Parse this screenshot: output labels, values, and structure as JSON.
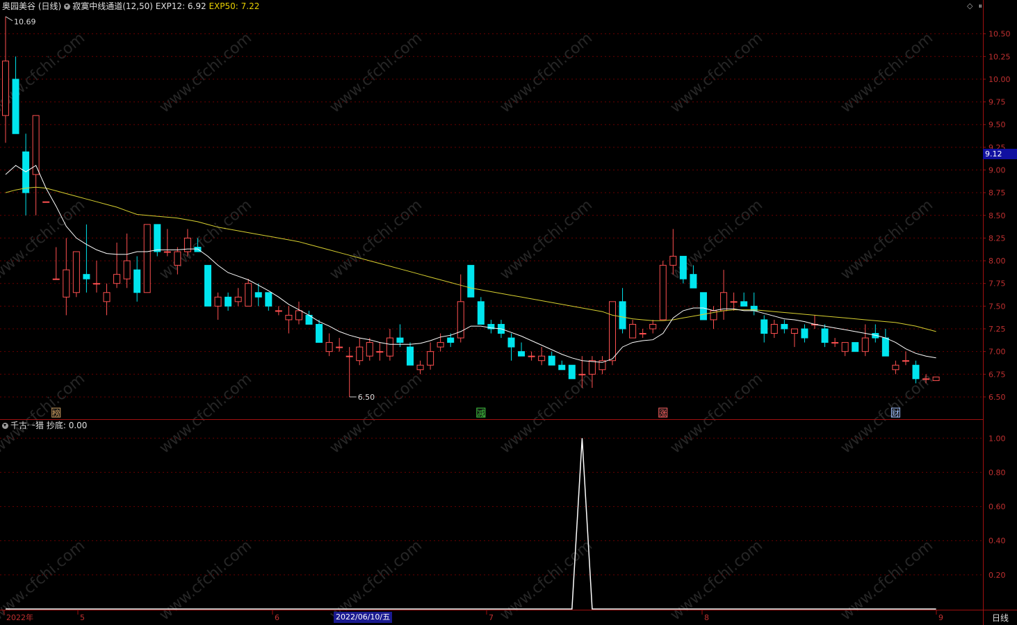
{
  "header": {
    "stock_name": "奥园美谷 (日线)",
    "indicator_name": "寂寞中线通道(12,50)",
    "exp12_label": "EXP12: 6.92",
    "exp50_label": "EXP50: 7.22"
  },
  "sub_header": {
    "indicator_name": "千古一猎",
    "value_label": "抄底: 0.00"
  },
  "price_axis": {
    "ticks": [
      "10.50",
      "10.25",
      "10.00",
      "9.75",
      "9.50",
      "9.25",
      "9.00",
      "8.75",
      "8.50",
      "8.25",
      "8.00",
      "7.75",
      "7.50",
      "7.25",
      "7.00",
      "6.75",
      "6.50"
    ],
    "current_price": "9.12"
  },
  "sub_axis": {
    "ticks": [
      "1.00",
      "0.80",
      "0.60",
      "0.40",
      "0.20"
    ]
  },
  "annotations": {
    "high": "10.69",
    "low": "6.50"
  },
  "event_markers": [
    {
      "label": "榜",
      "color": "#d0a060"
    },
    {
      "label": "减",
      "color": "#40d040"
    },
    {
      "label": "涨",
      "color": "#ff6060"
    },
    {
      "label": "财",
      "color": "#a0c0ff"
    }
  ],
  "date_axis": {
    "labels": [
      "2022年",
      "5",
      "6",
      "7",
      "8",
      "9"
    ],
    "cursor_date": "2022/06/10/五",
    "period": "日线"
  },
  "watermark": "www.cfchi.com",
  "colors": {
    "up": "#ff5050",
    "down": "#00e5ee",
    "exp12": "#ffffff",
    "exp50": "#d8d030",
    "grid": "#6a0000",
    "axis": "#a01010"
  },
  "chart_data": {
    "type": "candlestick",
    "ylim": [
      6.4,
      10.75
    ],
    "candles": [
      {
        "o": 9.6,
        "h": 10.69,
        "l": 9.3,
        "c": 10.2
      },
      {
        "o": 10.0,
        "h": 10.25,
        "l": 9.4,
        "c": 9.4
      },
      {
        "o": 9.2,
        "h": 9.4,
        "l": 8.5,
        "c": 8.75
      },
      {
        "o": 8.95,
        "h": 9.6,
        "l": 8.5,
        "c": 9.6
      },
      {
        "o": 8.65,
        "h": 8.65,
        "l": 8.65,
        "c": 8.65
      },
      {
        "o": 7.8,
        "h": 8.15,
        "l": 7.8,
        "c": 7.8
      },
      {
        "o": 7.6,
        "h": 8.25,
        "l": 7.4,
        "c": 7.9
      },
      {
        "o": 7.65,
        "h": 8.1,
        "l": 7.6,
        "c": 8.1
      },
      {
        "o": 7.85,
        "h": 8.4,
        "l": 7.65,
        "c": 7.8
      },
      {
        "o": 7.75,
        "h": 8.0,
        "l": 7.65,
        "c": 7.75
      },
      {
        "o": 7.55,
        "h": 7.75,
        "l": 7.4,
        "c": 7.65
      },
      {
        "o": 7.75,
        "h": 8.2,
        "l": 7.7,
        "c": 7.85
      },
      {
        "o": 7.8,
        "h": 8.3,
        "l": 7.7,
        "c": 8.0
      },
      {
        "o": 7.9,
        "h": 8.05,
        "l": 7.55,
        "c": 7.65
      },
      {
        "o": 7.65,
        "h": 8.35,
        "l": 7.65,
        "c": 8.4
      },
      {
        "o": 8.4,
        "h": 8.4,
        "l": 8.05,
        "c": 8.1
      },
      {
        "o": 8.1,
        "h": 8.35,
        "l": 8.05,
        "c": 8.1
      },
      {
        "o": 7.95,
        "h": 8.15,
        "l": 7.85,
        "c": 8.1
      },
      {
        "o": 8.1,
        "h": 8.35,
        "l": 8.05,
        "c": 8.25
      },
      {
        "o": 8.15,
        "h": 8.25,
        "l": 8.1,
        "c": 8.1
      },
      {
        "o": 7.95,
        "h": 7.95,
        "l": 7.5,
        "c": 7.5
      },
      {
        "o": 7.5,
        "h": 7.65,
        "l": 7.35,
        "c": 7.6
      },
      {
        "o": 7.6,
        "h": 7.65,
        "l": 7.45,
        "c": 7.5
      },
      {
        "o": 7.55,
        "h": 7.7,
        "l": 7.5,
        "c": 7.6
      },
      {
        "o": 7.5,
        "h": 7.8,
        "l": 7.5,
        "c": 7.75
      },
      {
        "o": 7.65,
        "h": 7.75,
        "l": 7.5,
        "c": 7.6
      },
      {
        "o": 7.65,
        "h": 7.65,
        "l": 7.45,
        "c": 7.5
      },
      {
        "o": 7.45,
        "h": 7.5,
        "l": 7.4,
        "c": 7.45
      },
      {
        "o": 7.35,
        "h": 7.5,
        "l": 7.2,
        "c": 7.4
      },
      {
        "o": 7.35,
        "h": 7.55,
        "l": 7.3,
        "c": 7.45
      },
      {
        "o": 7.4,
        "h": 7.45,
        "l": 7.3,
        "c": 7.3
      },
      {
        "o": 7.3,
        "h": 7.35,
        "l": 7.1,
        "c": 7.1
      },
      {
        "o": 7.0,
        "h": 7.2,
        "l": 6.95,
        "c": 7.1
      },
      {
        "o": 7.05,
        "h": 7.15,
        "l": 7.0,
        "c": 7.05
      },
      {
        "o": 6.95,
        "h": 7.05,
        "l": 6.5,
        "c": 6.95
      },
      {
        "o": 6.9,
        "h": 7.15,
        "l": 6.85,
        "c": 7.05
      },
      {
        "o": 6.95,
        "h": 7.15,
        "l": 6.9,
        "c": 7.1
      },
      {
        "o": 7.0,
        "h": 7.1,
        "l": 6.9,
        "c": 7.0
      },
      {
        "o": 6.95,
        "h": 7.25,
        "l": 6.9,
        "c": 7.15
      },
      {
        "o": 7.15,
        "h": 7.3,
        "l": 7.05,
        "c": 7.1
      },
      {
        "o": 7.05,
        "h": 7.1,
        "l": 6.85,
        "c": 6.85
      },
      {
        "o": 6.8,
        "h": 6.9,
        "l": 6.75,
        "c": 6.85
      },
      {
        "o": 6.85,
        "h": 7.1,
        "l": 6.8,
        "c": 7.0
      },
      {
        "o": 7.05,
        "h": 7.2,
        "l": 7.0,
        "c": 7.1
      },
      {
        "o": 7.15,
        "h": 7.2,
        "l": 7.05,
        "c": 7.1
      },
      {
        "o": 7.15,
        "h": 7.85,
        "l": 7.1,
        "c": 7.55
      },
      {
        "o": 7.95,
        "h": 7.95,
        "l": 7.6,
        "c": 7.6
      },
      {
        "o": 7.55,
        "h": 7.6,
        "l": 7.3,
        "c": 7.3
      },
      {
        "o": 7.3,
        "h": 7.35,
        "l": 7.2,
        "c": 7.25
      },
      {
        "o": 7.3,
        "h": 7.35,
        "l": 7.15,
        "c": 7.2
      },
      {
        "o": 7.15,
        "h": 7.2,
        "l": 6.9,
        "c": 7.05
      },
      {
        "o": 7.0,
        "h": 7.1,
        "l": 6.95,
        "c": 6.95
      },
      {
        "o": 6.95,
        "h": 7.0,
        "l": 6.9,
        "c": 6.95
      },
      {
        "o": 6.9,
        "h": 7.05,
        "l": 6.85,
        "c": 6.95
      },
      {
        "o": 6.95,
        "h": 7.0,
        "l": 6.85,
        "c": 6.85
      },
      {
        "o": 6.85,
        "h": 6.9,
        "l": 6.8,
        "c": 6.8
      },
      {
        "o": 6.85,
        "h": 6.85,
        "l": 6.7,
        "c": 6.7
      },
      {
        "o": 6.75,
        "h": 6.95,
        "l": 6.6,
        "c": 6.75
      },
      {
        "o": 6.75,
        "h": 6.95,
        "l": 6.6,
        "c": 6.9
      },
      {
        "o": 6.8,
        "h": 6.95,
        "l": 6.75,
        "c": 6.9
      },
      {
        "o": 6.9,
        "h": 7.55,
        "l": 6.85,
        "c": 7.55
      },
      {
        "o": 7.55,
        "h": 7.7,
        "l": 7.2,
        "c": 7.25
      },
      {
        "o": 7.15,
        "h": 7.35,
        "l": 7.15,
        "c": 7.3
      },
      {
        "o": 7.2,
        "h": 7.25,
        "l": 7.15,
        "c": 7.2
      },
      {
        "o": 7.25,
        "h": 7.35,
        "l": 7.2,
        "c": 7.3
      },
      {
        "o": 7.35,
        "h": 8.0,
        "l": 7.35,
        "c": 7.95
      },
      {
        "o": 7.95,
        "h": 8.35,
        "l": 7.85,
        "c": 8.05
      },
      {
        "o": 8.05,
        "h": 8.05,
        "l": 7.75,
        "c": 7.8
      },
      {
        "o": 7.85,
        "h": 7.95,
        "l": 7.7,
        "c": 7.7
      },
      {
        "o": 7.65,
        "h": 7.65,
        "l": 7.35,
        "c": 7.35
      },
      {
        "o": 7.35,
        "h": 7.5,
        "l": 7.25,
        "c": 7.45
      },
      {
        "o": 7.45,
        "h": 7.9,
        "l": 7.35,
        "c": 7.65
      },
      {
        "o": 7.55,
        "h": 7.65,
        "l": 7.45,
        "c": 7.55
      },
      {
        "o": 7.55,
        "h": 7.65,
        "l": 7.5,
        "c": 7.5
      },
      {
        "o": 7.5,
        "h": 7.65,
        "l": 7.4,
        "c": 7.45
      },
      {
        "o": 7.35,
        "h": 7.4,
        "l": 7.1,
        "c": 7.2
      },
      {
        "o": 7.2,
        "h": 7.35,
        "l": 7.15,
        "c": 7.3
      },
      {
        "o": 7.3,
        "h": 7.35,
        "l": 7.2,
        "c": 7.25
      },
      {
        "o": 7.2,
        "h": 7.25,
        "l": 7.05,
        "c": 7.25
      },
      {
        "o": 7.25,
        "h": 7.3,
        "l": 7.1,
        "c": 7.15
      },
      {
        "o": 7.3,
        "h": 7.4,
        "l": 7.25,
        "c": 7.3
      },
      {
        "o": 7.25,
        "h": 7.3,
        "l": 7.05,
        "c": 7.1
      },
      {
        "o": 7.1,
        "h": 7.15,
        "l": 7.05,
        "c": 7.1
      },
      {
        "o": 7.0,
        "h": 7.1,
        "l": 6.95,
        "c": 7.1
      },
      {
        "o": 7.1,
        "h": 7.1,
        "l": 7.0,
        "c": 7.0
      },
      {
        "o": 7.0,
        "h": 7.3,
        "l": 6.95,
        "c": 7.15
      },
      {
        "o": 7.2,
        "h": 7.3,
        "l": 7.1,
        "c": 7.15
      },
      {
        "o": 7.15,
        "h": 7.25,
        "l": 6.95,
        "c": 6.95
      },
      {
        "o": 6.8,
        "h": 6.9,
        "l": 6.75,
        "c": 6.85
      },
      {
        "o": 6.9,
        "h": 7.0,
        "l": 6.85,
        "c": 6.9
      },
      {
        "o": 6.85,
        "h": 6.9,
        "l": 6.65,
        "c": 6.7
      },
      {
        "o": 6.7,
        "h": 6.75,
        "l": 6.65,
        "c": 6.7
      },
      {
        "o": 6.68,
        "h": 6.72,
        "l": 6.68,
        "c": 6.72
      }
    ],
    "exp12": [
      8.95,
      9.05,
      8.98,
      9.05,
      8.8,
      8.6,
      8.38,
      8.25,
      8.18,
      8.12,
      8.08,
      8.07,
      8.07,
      8.1,
      8.1,
      8.12,
      8.12,
      8.12,
      8.13,
      8.13,
      8.05,
      7.95,
      7.87,
      7.83,
      7.79,
      7.73,
      7.67,
      7.6,
      7.52,
      7.46,
      7.4,
      7.33,
      7.28,
      7.22,
      7.18,
      7.15,
      7.13,
      7.1,
      7.08,
      7.08,
      7.08,
      7.09,
      7.12,
      7.16,
      7.18,
      7.22,
      7.28,
      7.28,
      7.26,
      7.25,
      7.21,
      7.17,
      7.12,
      7.07,
      7.02,
      6.97,
      6.93,
      6.9,
      6.89,
      6.88,
      6.92,
      7.05,
      7.1,
      7.12,
      7.13,
      7.2,
      7.37,
      7.45,
      7.48,
      7.48,
      7.45,
      7.47,
      7.47,
      7.45,
      7.45,
      7.42,
      7.39,
      7.36,
      7.35,
      7.33,
      7.3,
      7.28,
      7.26,
      7.24,
      7.22,
      7.2,
      7.18,
      7.15,
      7.1,
      7.03,
      6.98,
      6.95,
      6.93
    ],
    "exp50": [
      8.75,
      8.78,
      8.8,
      8.81,
      8.8,
      8.77,
      8.74,
      8.71,
      8.68,
      8.65,
      8.62,
      8.59,
      8.55,
      8.51,
      8.5,
      8.49,
      8.48,
      8.47,
      8.45,
      8.43,
      8.4,
      8.37,
      8.35,
      8.33,
      8.31,
      8.29,
      8.27,
      8.25,
      8.23,
      8.21,
      8.18,
      8.15,
      8.12,
      8.09,
      8.06,
      8.03,
      8.0,
      7.97,
      7.94,
      7.91,
      7.88,
      7.85,
      7.82,
      7.79,
      7.76,
      7.73,
      7.7,
      7.68,
      7.66,
      7.64,
      7.62,
      7.6,
      7.58,
      7.56,
      7.54,
      7.52,
      7.5,
      7.48,
      7.46,
      7.44,
      7.4,
      7.38,
      7.36,
      7.35,
      7.34,
      7.34,
      7.35,
      7.37,
      7.39,
      7.41,
      7.43,
      7.45,
      7.46,
      7.46,
      7.46,
      7.45,
      7.44,
      7.43,
      7.42,
      7.41,
      7.4,
      7.39,
      7.38,
      7.37,
      7.36,
      7.35,
      7.34,
      7.33,
      7.32,
      7.3,
      7.28,
      7.25,
      7.22
    ],
    "sub_indicator": {
      "name": "抄底",
      "ylim": [
        0,
        1.05
      ],
      "values_spike_index": 57
    }
  }
}
